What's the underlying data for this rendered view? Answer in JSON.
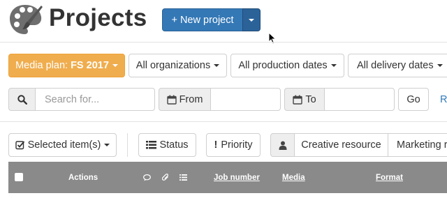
{
  "header": {
    "title": "Projects",
    "logo_icon": "palette-icon",
    "new_project_label": "+ New project",
    "brand_color": "#3478b6"
  },
  "filters": {
    "media_plan_prefix": "Media plan: ",
    "media_plan_value": "FS 2017",
    "organizations": "All organizations",
    "production_dates": "All production dates",
    "delivery_dates": "All delivery dates",
    "accent_color": "#f0ad4e"
  },
  "search": {
    "placeholder": "Search for...",
    "from_label": "From",
    "to_label": "To",
    "go_label": "Go",
    "reset_partial": "R"
  },
  "actions": {
    "selected_items_label": "Selected item(s)",
    "status_label": "Status",
    "priority_label": "Priority",
    "creative_resource_label": "Creative resource",
    "marketing_label": "Marketing r"
  },
  "table": {
    "header_color": "#8a8a8a",
    "columns": {
      "actions": "Actions",
      "job_number": "Job number",
      "media": "Media",
      "format": "Format"
    }
  }
}
